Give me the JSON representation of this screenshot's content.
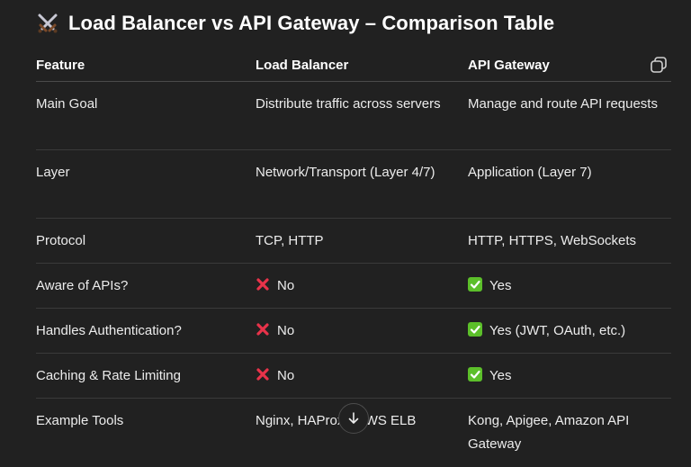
{
  "heading": {
    "icon": "crossed-swords-icon",
    "title": "Load Balancer vs API Gateway – Comparison Table"
  },
  "table": {
    "columns": [
      "Feature",
      "Load Balancer",
      "API Gateway"
    ],
    "rows": [
      {
        "feature": "Main Goal",
        "lb": "Distribute traffic across servers",
        "gw": "Manage and route API requests"
      },
      {
        "feature": "Layer",
        "lb": "Network/Transport (Layer 4/7)",
        "gw": "Application (Layer 7)"
      },
      {
        "feature": "Protocol",
        "lb": "TCP, HTTP",
        "gw": "HTTP, HTTPS, WebSockets"
      },
      {
        "feature": "Aware of APIs?",
        "lb": "No",
        "lb_icon": "cross-mark-icon",
        "gw": "Yes",
        "gw_icon": "check-mark-icon"
      },
      {
        "feature": "Handles Authentication?",
        "lb": "No",
        "lb_icon": "cross-mark-icon",
        "gw": "Yes (JWT, OAuth, etc.)",
        "gw_icon": "check-mark-icon"
      },
      {
        "feature": "Caching & Rate Limiting",
        "lb": "No",
        "lb_icon": "cross-mark-icon",
        "gw": "Yes",
        "gw_icon": "check-mark-icon"
      },
      {
        "feature": "Example Tools",
        "lb": "Nginx, HAProxy, AWS ELB",
        "gw": "Kong, Apigee, Amazon API Gateway"
      }
    ]
  },
  "controls": {
    "copy_icon": "copy-icon",
    "scroll_icon": "arrow-down-icon"
  },
  "colors": {
    "background": "#212121",
    "text": "#ececec",
    "cross": "#e8334a",
    "check_bg": "#5cbf2a"
  }
}
